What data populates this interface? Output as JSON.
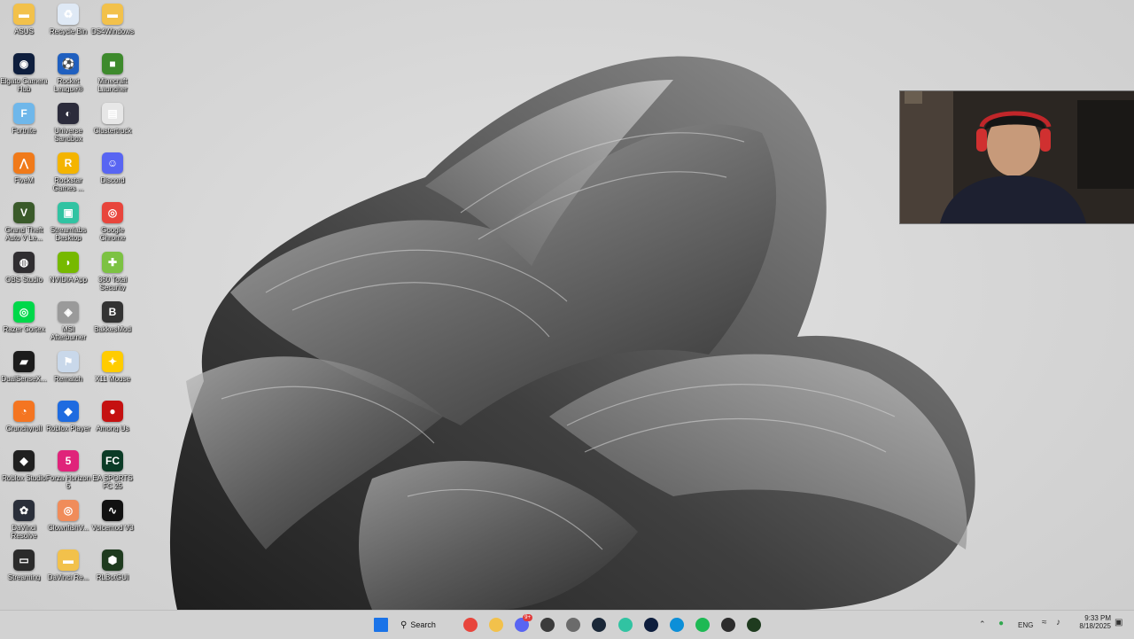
{
  "desktop": {
    "icons": [
      {
        "label": "ASUS",
        "icon": "folder-icon",
        "color": "#f2c14b",
        "glyph": "▬"
      },
      {
        "label": "Recycle Bin",
        "icon": "recycle-bin-icon",
        "color": "#dfe9f5",
        "glyph": "♻"
      },
      {
        "label": "DS4Windows",
        "icon": "folder-icon",
        "color": "#f2c14b",
        "glyph": "▬"
      },
      {
        "label": "Elgato Camera Hub",
        "icon": "elgato-icon",
        "color": "#0e1e3d",
        "glyph": "◉"
      },
      {
        "label": "Rocket League®",
        "icon": "rocket-league-icon",
        "color": "#1f5fbf",
        "glyph": "⚽"
      },
      {
        "label": "Minecraft Launcher",
        "icon": "minecraft-icon",
        "color": "#3d8a2c",
        "glyph": "■"
      },
      {
        "label": "Fortnite",
        "icon": "fortnite-icon",
        "color": "#6fb7ea",
        "glyph": "F"
      },
      {
        "label": "Universe Sandbox",
        "icon": "universe-sandbox-icon",
        "color": "#2b2b3b",
        "glyph": "◐"
      },
      {
        "label": "Clustertruck",
        "icon": "clustertruck-icon",
        "color": "#e7e7e7",
        "glyph": "▤"
      },
      {
        "label": "FiveM",
        "icon": "fivem-icon",
        "color": "#f07a1a",
        "glyph": "⋀"
      },
      {
        "label": "Rockstar Games ...",
        "icon": "rockstar-icon",
        "color": "#f4b400",
        "glyph": "R"
      },
      {
        "label": "Discord",
        "icon": "discord-icon",
        "color": "#5865f2",
        "glyph": "☺"
      },
      {
        "label": "Grand Theft Auto V Le...",
        "icon": "gta-icon",
        "color": "#3a5a2a",
        "glyph": "V"
      },
      {
        "label": "Streamlabs Desktop",
        "icon": "streamlabs-icon",
        "color": "#31c3a2",
        "glyph": "▣"
      },
      {
        "label": "Google Chrome",
        "icon": "chrome-icon",
        "color": "#e8453c",
        "glyph": "◎"
      },
      {
        "label": "OBS Studio",
        "icon": "obs-icon",
        "color": "#302e31",
        "glyph": "◍"
      },
      {
        "label": "NVIDIA App",
        "icon": "nvidia-icon",
        "color": "#76b900",
        "glyph": "◗"
      },
      {
        "label": "360 Total Security",
        "icon": "shield-icon",
        "color": "#7cc242",
        "glyph": "✚"
      },
      {
        "label": "Razer Cortex",
        "icon": "razer-cortex-icon",
        "color": "#00d84a",
        "glyph": "◎"
      },
      {
        "label": "MSI Afterburner",
        "icon": "msi-afterburner-icon",
        "color": "#9a9a9a",
        "glyph": "◈"
      },
      {
        "label": "BakkesMod",
        "icon": "bakkesmod-icon",
        "color": "#333333",
        "glyph": "B"
      },
      {
        "label": "DualSenseX...",
        "icon": "dualsense-icon",
        "color": "#1c1c1c",
        "glyph": "▰"
      },
      {
        "label": "Rematch",
        "icon": "rematch-icon",
        "color": "#c9d8ea",
        "glyph": "⚑"
      },
      {
        "label": "X11 Mouse",
        "icon": "mouse-icon",
        "color": "#ffcc00",
        "glyph": "✦"
      },
      {
        "label": "Crunchyroll",
        "icon": "crunchyroll-icon",
        "color": "#f47521",
        "glyph": "◔"
      },
      {
        "label": "Roblox Player",
        "icon": "roblox-icon",
        "color": "#1e6be0",
        "glyph": "◆"
      },
      {
        "label": "Among Us",
        "icon": "among-us-icon",
        "color": "#c51111",
        "glyph": "●"
      },
      {
        "label": "Roblox Studio",
        "icon": "roblox-studio-icon",
        "color": "#202020",
        "glyph": "◆"
      },
      {
        "label": "Forza Horizon 5",
        "icon": "forza-icon",
        "color": "#e0237a",
        "glyph": "5"
      },
      {
        "label": "EA SPORTS FC 25",
        "icon": "ea-fc-icon",
        "color": "#0b3b26",
        "glyph": "FC"
      },
      {
        "label": "DaVinci Resolve",
        "icon": "davinci-icon",
        "color": "#2a2f3a",
        "glyph": "✿"
      },
      {
        "label": "ClownfishV...",
        "icon": "clownfish-icon",
        "color": "#f08c5a",
        "glyph": "◎"
      },
      {
        "label": "Voicemod V3",
        "icon": "voicemod-icon",
        "color": "#111111",
        "glyph": "∿"
      },
      {
        "label": "Streaming",
        "icon": "monitor-icon",
        "color": "#2b2b2b",
        "glyph": "▭"
      },
      {
        "label": "DaVinci Re...",
        "icon": "folder-icon",
        "color": "#f2c14b",
        "glyph": "▬"
      },
      {
        "label": "RLBotGUI",
        "icon": "rlbot-icon",
        "color": "#1f3b1f",
        "glyph": "⬢"
      }
    ]
  },
  "taskbar": {
    "search_label": "Search",
    "apps": [
      {
        "name": "start-button",
        "icon": "windows-icon",
        "color": "#1a73e8"
      },
      {
        "name": "chrome-taskbar-button",
        "icon": "chrome-icon",
        "color": "#e8453c"
      },
      {
        "name": "file-explorer-taskbar-button",
        "icon": "folder-icon",
        "color": "#f2c14b"
      },
      {
        "name": "discord-taskbar-button",
        "icon": "discord-icon",
        "color": "#5865f2",
        "badge": "9+"
      },
      {
        "name": "store-taskbar-button",
        "icon": "store-icon",
        "color": "#3b3b3b"
      },
      {
        "name": "settings-taskbar-button",
        "icon": "gear-icon",
        "color": "#6b6b6b"
      },
      {
        "name": "steam-taskbar-button",
        "icon": "steam-icon",
        "color": "#1b2838"
      },
      {
        "name": "streamlabs-taskbar-button",
        "icon": "streamlabs-icon",
        "color": "#31c3a2"
      },
      {
        "name": "elgato-taskbar-button",
        "icon": "elgato-icon",
        "color": "#0e1e3d"
      },
      {
        "name": "edge-taskbar-button",
        "icon": "edge-icon",
        "color": "#0c8fd8"
      },
      {
        "name": "spotify-taskbar-button",
        "icon": "spotify-icon",
        "color": "#1db954"
      },
      {
        "name": "terminal-taskbar-button",
        "icon": "terminal-icon",
        "color": "#2d2d2d"
      },
      {
        "name": "rlbot-taskbar-button",
        "icon": "rlbot-icon",
        "color": "#1f3b1f"
      }
    ],
    "tray": {
      "language": "ENG",
      "time": "9:33 PM",
      "date": "8/18/2025"
    }
  }
}
